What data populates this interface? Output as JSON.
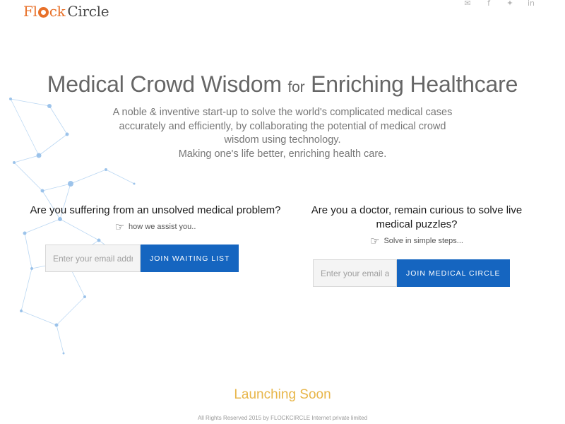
{
  "header": {
    "logo_part1": "Fl",
    "logo_part2": "ck",
    "logo_part3": "Circle",
    "social_icons": [
      "envelope-icon",
      "facebook-icon",
      "twitter-icon",
      "linkedin-icon"
    ],
    "social_glyphs": [
      "✉",
      "f",
      "✦",
      "in"
    ]
  },
  "hero": {
    "title_part1": "Medical Crowd Wisdom ",
    "title_part2": "for",
    "title_part3": " Enriching Healthcare",
    "desc_line1": "A noble & inventive start-up to solve the world's complicated medical cases accurately and efficiently, by collaborating the potential of medical crowd wisdom using technology.",
    "desc_line2": "Making one's life better, enriching health care."
  },
  "patients": {
    "question": "Are you suffering from an unsolved medical problem?",
    "hint": "how we assist you..",
    "email_placeholder": "Enter your email address",
    "button_label": "JOIN WAITING LIST"
  },
  "doctors": {
    "question": "Are you a doctor, remain curious to solve live medical puzzles?",
    "hint": "Solve in simple steps...",
    "email_placeholder": "Enter your email address",
    "button_label": "JOIN MEDICAL CIRCLE"
  },
  "launching": "Launching Soon",
  "footer": "All Rights Reserved 2015 by FLOCKCIRCLE Internet private limited",
  "colors": {
    "accent_orange": "#e8712a",
    "button_blue": "#1565c0",
    "launching_gold": "#e8b64a"
  }
}
